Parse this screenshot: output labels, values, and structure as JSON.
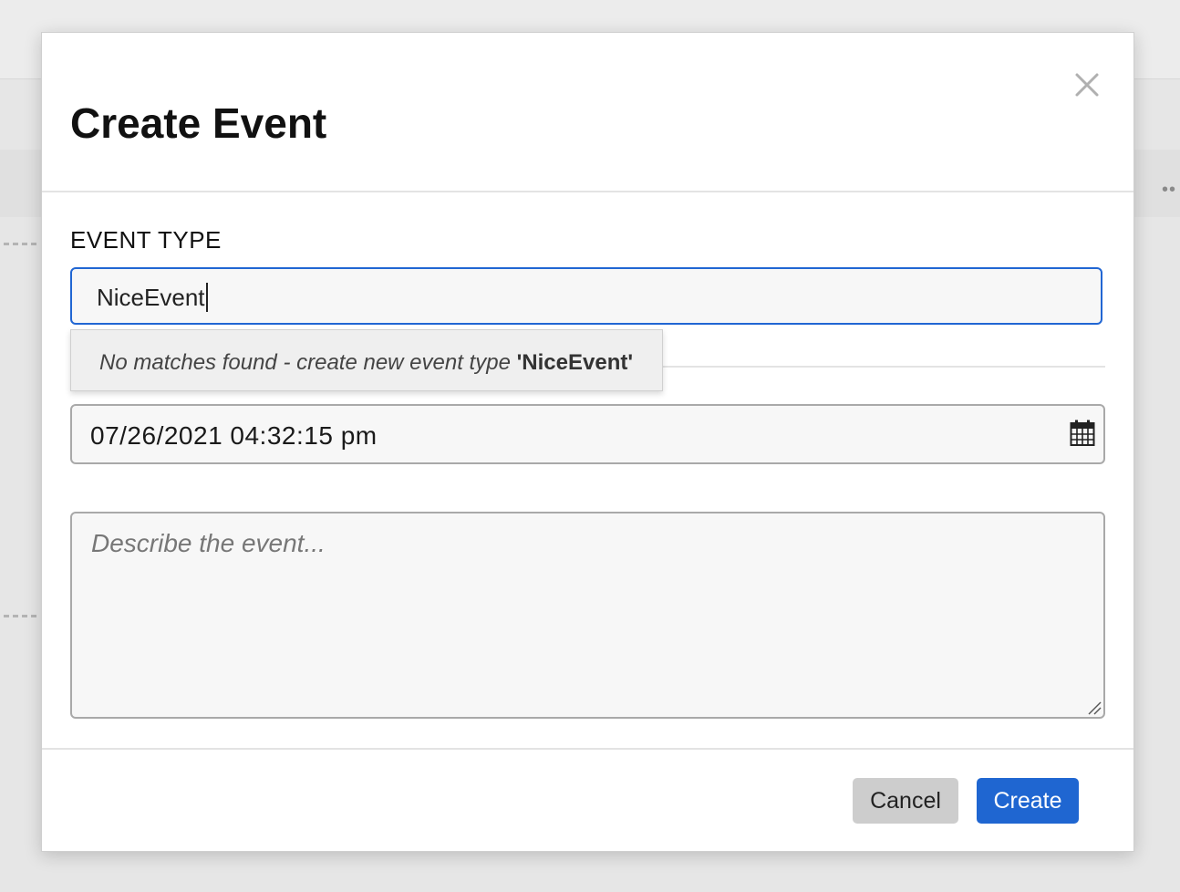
{
  "modal": {
    "title": "Create Event"
  },
  "event_type": {
    "label": "EVENT TYPE",
    "value": "NiceEvent"
  },
  "suggestion": {
    "prefix": "No matches found - create new event type ",
    "name": "'NiceEvent'"
  },
  "datetime": {
    "value": "07/26/2021 04:32:15 pm"
  },
  "description": {
    "placeholder": "Describe the event..."
  },
  "footer": {
    "cancel_label": "Cancel",
    "create_label": "Create"
  },
  "icons": {
    "close": "close-icon",
    "calendar": "calendar-icon",
    "resize": "resize-handle-icon"
  },
  "colors": {
    "accent": "#1f66d1",
    "focus_border": "#2166d3"
  }
}
